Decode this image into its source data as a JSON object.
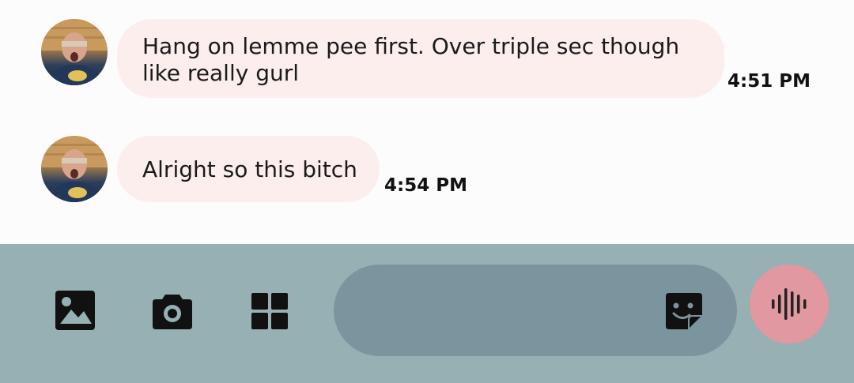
{
  "messages": [
    {
      "text_line1": "Hang on lemme pee first. Over triple sec though",
      "text_line2": "like really gurl",
      "time": "4:51 PM"
    },
    {
      "text_line1": "Alright so this bitch",
      "time": "4:54 PM"
    }
  ],
  "composer": {
    "placeholder": "",
    "icons": [
      "gallery-icon",
      "camera-icon",
      "apps-grid-icon",
      "sticker-icon",
      "voice-waveform-icon"
    ]
  },
  "colors": {
    "bubble": "#fdeeee",
    "composer_bg": "#96b0b4",
    "input_bg": "#7a959d",
    "voice_button": "#e198a0"
  }
}
